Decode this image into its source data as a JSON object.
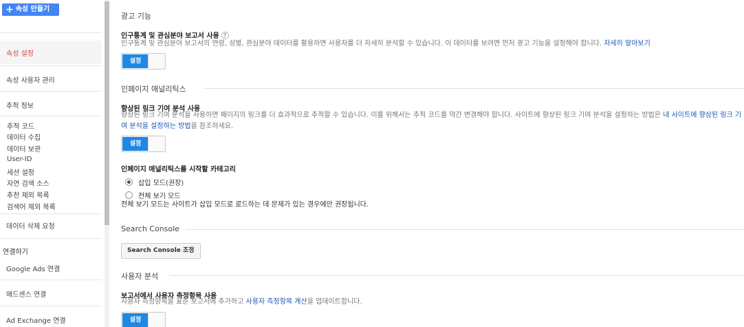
{
  "sidebar": {
    "create_property": "속성 만들기",
    "items": {
      "property_settings": "속성 설정",
      "property_user_management": "속성 사용자 관리",
      "tracking_info": "추적 정보",
      "tracking_code": "추적 코드",
      "data_collection": "데이터 수집",
      "data_retention": "데이터 보관",
      "user_id": "User-ID",
      "session_settings": "세션 설정",
      "organic_search_sources": "자연 검색 소스",
      "referral_exclusion": "추천 제외 목록",
      "search_term_exclusion": "검색어 제외 목록",
      "data_deletion_requests": "데이터 삭제 요청",
      "linking_heading": "연결하기",
      "google_ads_linking": "Google Ads 연결",
      "adsense_linking": "애드센스 연결",
      "ad_exchange_linking": "Ad Exchange 연결"
    }
  },
  "main": {
    "ads_features": {
      "title": "광고 기능",
      "label": "인구통계 및 관심분야 보고서 사용",
      "desc": "인구통계 및 관심분야 보고서의 연령, 성별, 관심분야 데이터를 활용하면 사용자를 더 자세히 분석할 수 있습니다. 이 데이터를 보려면 먼저 광고 기능을 설정해야 합니다.",
      "link": "자세히 알아보기",
      "toggle": "설정"
    },
    "inpage": {
      "title": "인페이지 애널리틱스",
      "label": "향상된 링크 기여 분석 사용",
      "desc_part1": "향상된 링크 기여 분석을 사용하면 페이지의 링크를 더 효과적으로 추적할 수 있습니다. 이를 위해서는 추적 코드를 약간 변경해야 합니다. 사이트에 향상된 링크 기여 분석을 설정하는 방법은",
      "desc_link": "내 사이트에 향상된 링크 기여 분석을 설정하는 방법",
      "desc_part2": "을 참조하세요.",
      "toggle": "설정",
      "category_label": "인페이지 애널리틱스를 시작할 카테고리",
      "option_insert": "삽입 모드(권장)",
      "option_full": "전체 보기 모드",
      "note": "전체 보기 모드는 사이트가 삽입 모드로 로드하는 데 문제가 있는 경우에만 권장됩니다."
    },
    "search_console": {
      "title": "Search Console",
      "button": "Search Console 조정"
    },
    "user_analysis": {
      "title": "사용자 분석",
      "label": "보고서에서 사용자 측정항목 사용",
      "desc_part1": "사용자 측정항목을 표준 보고서에 추가하고",
      "desc_link": "사용자 측정항목 계산",
      "desc_part2": "을 업데이트합니다.",
      "toggle": "설정"
    }
  }
}
